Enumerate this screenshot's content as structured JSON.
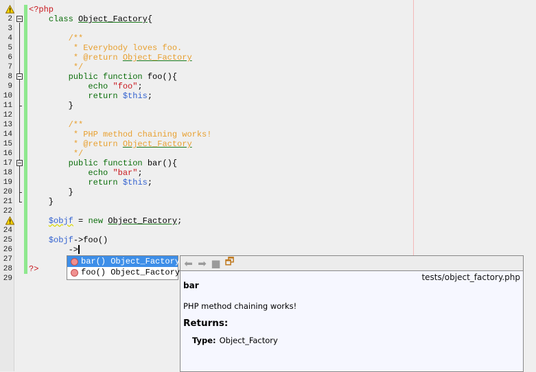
{
  "editor": {
    "lines": [
      [
        [
          "<?php",
          "t"
        ]
      ],
      [
        [
          "    "
        ],
        [
          "class",
          "k"
        ],
        [
          " "
        ],
        [
          "Object_Factory",
          "u"
        ],
        [
          "{"
        ]
      ],
      [
        [
          ""
        ]
      ],
      [
        [
          "        "
        ],
        [
          "/**",
          "c"
        ]
      ],
      [
        [
          "         "
        ],
        [
          "* Everybody loves foo.",
          "c"
        ]
      ],
      [
        [
          "         "
        ],
        [
          "* @return ",
          "c"
        ],
        [
          "Object_Factory",
          "cu"
        ]
      ],
      [
        [
          "         "
        ],
        [
          "*/",
          "c"
        ]
      ],
      [
        [
          "        "
        ],
        [
          "public function",
          "k"
        ],
        [
          " foo(){"
        ]
      ],
      [
        [
          "            "
        ],
        [
          "echo",
          "k"
        ],
        [
          " "
        ],
        [
          "\"foo\"",
          "s"
        ],
        [
          ";"
        ]
      ],
      [
        [
          "            "
        ],
        [
          "return",
          "k"
        ],
        [
          " "
        ],
        [
          "$this",
          "v"
        ],
        [
          ";"
        ]
      ],
      [
        [
          "        }"
        ]
      ],
      [
        [
          ""
        ]
      ],
      [
        [
          "        "
        ],
        [
          "/**",
          "c"
        ]
      ],
      [
        [
          "         "
        ],
        [
          "* PHP method chaining works!",
          "c"
        ]
      ],
      [
        [
          "         "
        ],
        [
          "* @return ",
          "c"
        ],
        [
          "Object_Factory",
          "cu"
        ]
      ],
      [
        [
          "         "
        ],
        [
          "*/",
          "c"
        ]
      ],
      [
        [
          "        "
        ],
        [
          "public function",
          "k"
        ],
        [
          " bar(){"
        ]
      ],
      [
        [
          "            "
        ],
        [
          "echo",
          "k"
        ],
        [
          " "
        ],
        [
          "\"bar\"",
          "s"
        ],
        [
          ";"
        ]
      ],
      [
        [
          "            "
        ],
        [
          "return",
          "k"
        ],
        [
          " "
        ],
        [
          "$this",
          "v"
        ],
        [
          ";"
        ]
      ],
      [
        [
          "        }"
        ]
      ],
      [
        [
          "    }"
        ]
      ],
      [
        [
          ""
        ]
      ],
      [
        [
          "    "
        ],
        [
          "$objf",
          "v w"
        ],
        [
          " = "
        ],
        [
          "new",
          "k"
        ],
        [
          " "
        ],
        [
          "Object_Factory",
          "u"
        ],
        [
          ";"
        ]
      ],
      [
        [
          ""
        ]
      ],
      [
        [
          "    "
        ],
        [
          "$objf",
          "v"
        ],
        [
          "->foo()"
        ]
      ],
      [
        [
          "        ->"
        ]
      ],
      [
        [
          ""
        ]
      ],
      [
        [
          "?>",
          "t"
        ]
      ],
      [
        [
          ""
        ]
      ]
    ],
    "line_numbers": [
      "1",
      "2",
      "3",
      "4",
      "5",
      "6",
      "7",
      "8",
      "9",
      "10",
      "11",
      "12",
      "13",
      "14",
      "15",
      "16",
      "17",
      "18",
      "19",
      "20",
      "21",
      "22",
      "23",
      "24",
      "25",
      "26",
      "27",
      "28",
      "29"
    ]
  },
  "completion": {
    "items": [
      {
        "label": "bar() Object_Factory",
        "selected": true
      },
      {
        "label": "foo() Object_Factory",
        "selected": false
      }
    ]
  },
  "doc": {
    "path": "tests/object_factory.php",
    "name": "bar",
    "description": "PHP method chaining works!",
    "returns_heading": "Returns:",
    "type_label": "Type:",
    "type_value": "Object_Factory"
  },
  "colors": {
    "selection": "#3d8ee8",
    "change_bar": "#8ee88e"
  }
}
